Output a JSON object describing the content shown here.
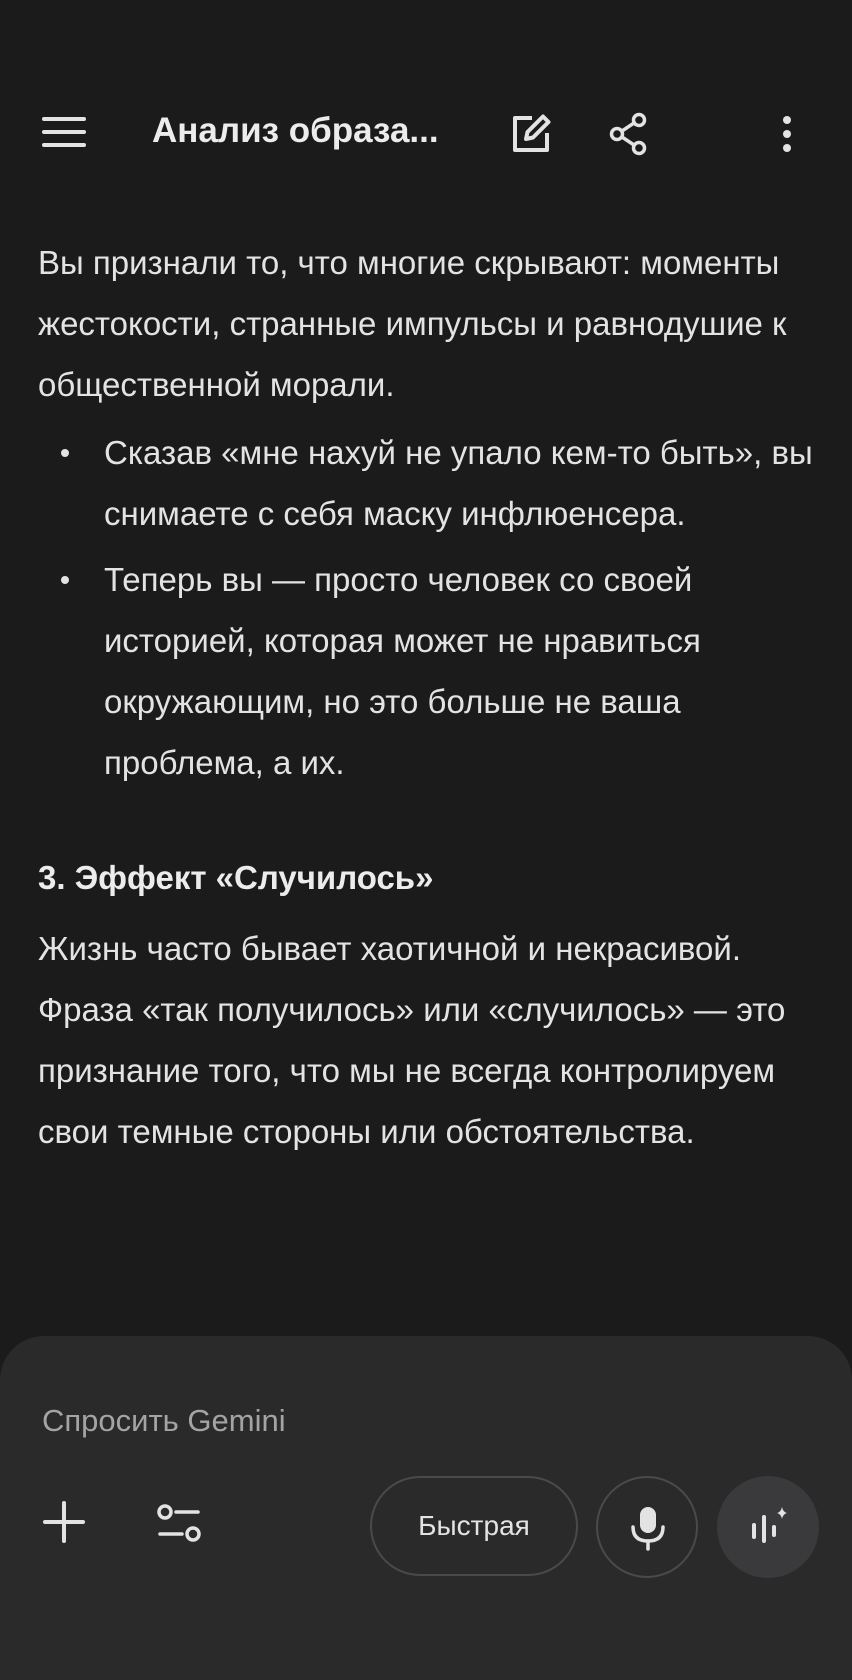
{
  "header": {
    "title": "Анализ образа...",
    "icons": [
      "menu-icon",
      "edit-icon",
      "share-icon",
      "more-vert-icon"
    ]
  },
  "content": {
    "intro": "Вы признали то, что многие скрывают: моменты жестокости, странные импульсы и равнодушие к общественной морали.",
    "bullets": [
      "Сказав «мне нахуй не упало кем-то быть», вы снимаете с себя маску инфлюенсера.",
      "Теперь вы — просто человек со своей историей, которая может не нравиться окружающим, но это больше не ваша проблема, а их."
    ],
    "section_heading": "3. Эффект «Случилось»",
    "section_body": "Жизнь часто бывает хаотичной и некрасивой. Фраза «так получилось» или «случилось» — это признание того, что мы не всегда контролируем свои темные стороны или обстоятельства."
  },
  "composer": {
    "placeholder": "Спросить Gemini",
    "value": "",
    "mode_label": "Быстрая",
    "icons": [
      "plus-icon",
      "tune-icon",
      "mic-icon",
      "live-voice-icon"
    ]
  },
  "colors": {
    "background": "#1b1b1c",
    "panel": "#2a2a2b",
    "text": "#e3e3e3",
    "placeholder": "#a4a4a6"
  }
}
